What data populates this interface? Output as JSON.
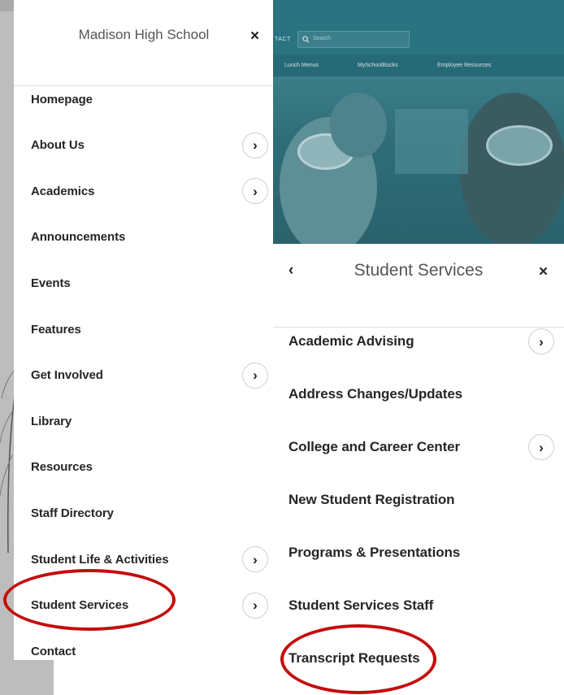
{
  "left_menu": {
    "title": "Madison High School",
    "close_glyph": "×",
    "items": [
      {
        "label": "Homepage",
        "has_submenu": false
      },
      {
        "label": "About Us",
        "has_submenu": true
      },
      {
        "label": "Academics",
        "has_submenu": true
      },
      {
        "label": "Announcements",
        "has_submenu": false
      },
      {
        "label": "Events",
        "has_submenu": false
      },
      {
        "label": "Features",
        "has_submenu": false
      },
      {
        "label": "Get Involved",
        "has_submenu": true
      },
      {
        "label": "Library",
        "has_submenu": false
      },
      {
        "label": "Resources",
        "has_submenu": false
      },
      {
        "label": "Staff Directory",
        "has_submenu": false
      },
      {
        "label": "Student Life & Activities",
        "has_submenu": true
      },
      {
        "label": "Student Services",
        "has_submenu": true
      },
      {
        "label": "Contact",
        "has_submenu": false
      }
    ]
  },
  "hero": {
    "contact_label": "TACT",
    "search_placeholder": "Search",
    "nav": [
      "Lunch Menus",
      "MySchoolBucks",
      "Employee Resources"
    ]
  },
  "right_menu": {
    "back_glyph": "‹",
    "title": "Student Services",
    "close_glyph": "×",
    "items": [
      {
        "label": "Academic Advising",
        "has_submenu": true
      },
      {
        "label": "Address Changes/Updates",
        "has_submenu": false
      },
      {
        "label": "College and Career Center",
        "has_submenu": true
      },
      {
        "label": "New Student Registration",
        "has_submenu": false
      },
      {
        "label": "Programs & Presentations",
        "has_submenu": false
      },
      {
        "label": "Student Services Staff",
        "has_submenu": false
      },
      {
        "label": "Transcript Requests",
        "has_submenu": false
      }
    ]
  },
  "icons": {
    "chevron_right": "chevron-right-icon",
    "close": "close-icon",
    "back": "chevron-left-icon",
    "search": "search-icon"
  },
  "colors": {
    "annotation_red": "#c40d0d",
    "hero_teal": "#2f6e79",
    "text_dark": "#262626",
    "title_gray": "#555555"
  }
}
